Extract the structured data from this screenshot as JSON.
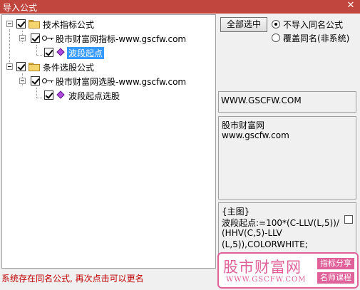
{
  "window": {
    "title": "导入公式",
    "close_glyph": "✕"
  },
  "tree": {
    "group1": {
      "label": "技术指标公式"
    },
    "group1_source": {
      "label": "股市财富网指标-www.gscfw.com"
    },
    "group1_item": {
      "label": "波段起点"
    },
    "group2": {
      "label": "条件选股公式"
    },
    "group2_source": {
      "label": "股市财富网选股-www.gscfw.com"
    },
    "group2_item": {
      "label": "波段起点选股"
    }
  },
  "controls": {
    "select_all_label": "全部选中",
    "radio_skip_label": "不导入同名公式",
    "radio_overwrite_label": "覆盖同名(非系统)",
    "selected_option": "skip"
  },
  "info": {
    "url": "WWW.GSCFW.COM",
    "description_line1": "股市财富网",
    "description_line2": "www.gscfw.com"
  },
  "code": {
    "lines": [
      "{主图}",
      "波段起点:=100*(C-LLV(L,5))/",
      "(HHV(C,5)-LLV",
      "(L,5)),COLORWHITE;"
    ]
  },
  "status": {
    "message": "系统存在同名公式, 再次点击可以更名"
  },
  "watermark": {
    "brand": "股市财富网",
    "url": "WWW.GSCFW.COM",
    "tag1": "指标分享",
    "tag2": "名师课程",
    "color": "#e0609a"
  },
  "colors": {
    "titlebar": "#c0463e",
    "selection": "#3399ff",
    "status_text": "#c00000"
  },
  "icons": {
    "group": "folder-icon",
    "source": "key-icon",
    "item": "purple-diamond-icon"
  }
}
